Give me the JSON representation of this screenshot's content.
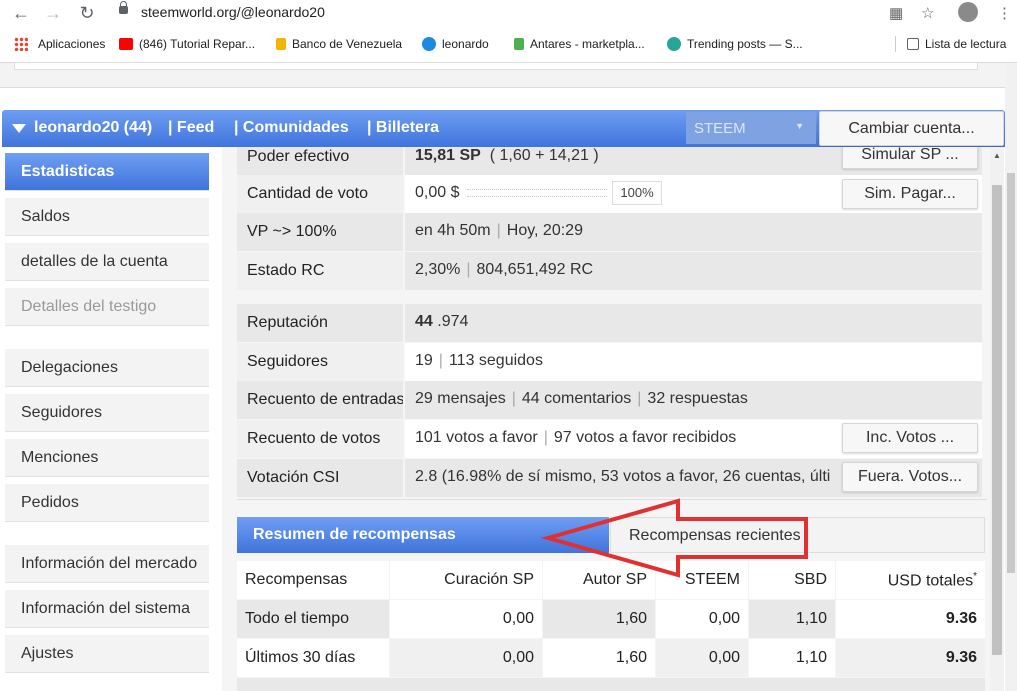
{
  "browser": {
    "url": "steemworld.org/@leonardo20",
    "bookmarks": [
      {
        "label": "Aplicaciones",
        "color": "#ea4335"
      },
      {
        "label": "(846) Tutorial Repar...",
        "color": "#ff0000"
      },
      {
        "label": "Banco de Venezuela",
        "color": "#f4b400"
      },
      {
        "label": "leonardo",
        "color": "#1e88e5"
      },
      {
        "label": "Antares - marketpla...",
        "color": "#4caf50"
      },
      {
        "label": "Trending posts — S...",
        "color": "#26a69a"
      }
    ],
    "reading_list": "Lista de lectura"
  },
  "header": {
    "account": "leonardo20 (44)",
    "links": [
      "| Feed",
      "| Comunidades",
      "| Billetera"
    ],
    "select_value": "STEEM",
    "change_account": "Cambiar cuenta..."
  },
  "sidebar": {
    "items": [
      {
        "label": "Estadisticas",
        "state": "active"
      },
      {
        "label": "Saldos",
        "state": "normal"
      },
      {
        "label": "detalles de la cuenta",
        "state": "normal"
      },
      {
        "label": "Detalles del testigo",
        "state": "disabled"
      },
      {
        "label": "Delegaciones",
        "state": "normal"
      },
      {
        "label": "Seguidores",
        "state": "normal"
      },
      {
        "label": "Menciones",
        "state": "normal"
      },
      {
        "label": "Pedidos",
        "state": "normal"
      },
      {
        "label": "Información del mercado",
        "state": "normal"
      },
      {
        "label": "Información del sistema",
        "state": "normal"
      },
      {
        "label": "Ajustes",
        "state": "normal"
      }
    ]
  },
  "stats": {
    "poder_label": "Poder efectivo",
    "poder_value": "15,81 SP",
    "poder_detail": "( 1,60 + 14,21 )",
    "simular_sp": "Simular SP ...",
    "voto_label": "Cantidad de voto",
    "voto_value": "0,00 $",
    "voto_pct": "100%",
    "sim_pagar": "Sim. Pagar...",
    "vp_label": "VP ~> 100%",
    "vp_time": "en 4h 50m",
    "vp_when": "Hoy, 20:29",
    "rc_label": "Estado RC",
    "rc_pct": "2,30%",
    "rc_value": "804,651,492 RC",
    "rep_label": "Reputación",
    "rep_int": "44",
    "rep_dec": ".974",
    "seg_label": "Seguidores",
    "seg_count": "19",
    "seg_following": "113 seguidos",
    "entradas_label": "Recuento de entradas",
    "entradas_posts": "29 mensajes",
    "entradas_comments": "44 comentarios",
    "entradas_replies": "32 respuestas",
    "votos_label": "Recuento de votos",
    "votos_favor": "101 votos a favor",
    "votos_recibidos": "97 votos a favor recibidos",
    "inc_votos": "Inc. Votos ...",
    "csi_label": "Votación CSI",
    "csi_value": "2.8",
    "csi_detail": "(16.98% de sí mismo, 53 votos a favor, 26 cuentas, últi",
    "fuera_votos": "Fuera. Votos..."
  },
  "rewards": {
    "tab_summary": "Resumen de recompensas",
    "tab_recent": "Recompensas recientes",
    "columns": [
      "Recompensas",
      "Curación SP",
      "Autor SP",
      "STEEM",
      "SBD",
      "USD totales"
    ],
    "usd_mark": "*",
    "rows": [
      {
        "label": "Todo el tiempo",
        "cells": [
          "0,00",
          "1,60",
          "0,00",
          "1,10",
          "9.36"
        ]
      },
      {
        "label": "Últimos 30 días",
        "cells": [
          "0,00",
          "1,60",
          "0,00",
          "1,10",
          "9.36"
        ]
      }
    ]
  },
  "annotation_color": "#e03030"
}
